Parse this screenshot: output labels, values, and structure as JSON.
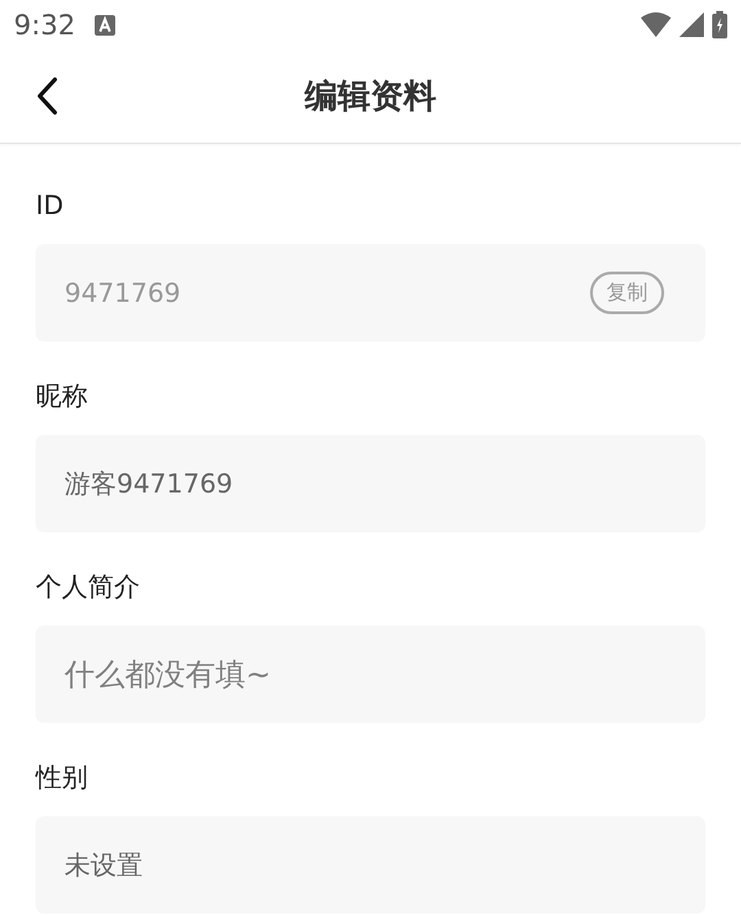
{
  "status_bar": {
    "time": "9:32"
  },
  "header": {
    "title": "编辑资料"
  },
  "fields": [
    {
      "kind": "readonly",
      "label": "ID",
      "value": "9471769",
      "action": "复制"
    },
    {
      "kind": "input",
      "label": "昵称",
      "value": "游客9471769"
    },
    {
      "kind": "textarea",
      "label": "个人简介",
      "placeholder": "什么都没有填~"
    },
    {
      "kind": "select",
      "label": "性别",
      "value": "未设置"
    }
  ]
}
